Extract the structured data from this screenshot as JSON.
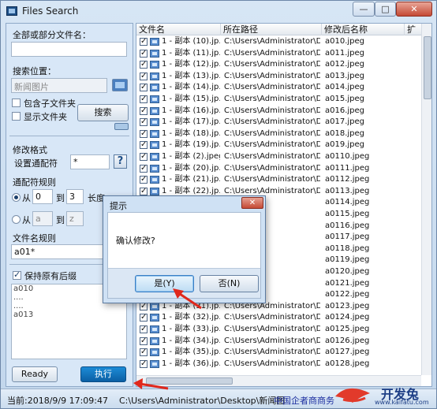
{
  "window": {
    "title": "Files Search",
    "buttons": {
      "minimize": "—",
      "maximize": "□",
      "close": "✕"
    }
  },
  "left": {
    "filename_label": "全部或部分文件名：",
    "filename_value": "",
    "location_label": "搜索位置：",
    "location_value": "新闻图片",
    "include_subfolders": "包含子文件夹",
    "show_folders": "显示文件夹",
    "search_button": "搜索",
    "modify_format_label": "修改格式",
    "wildcard_label": "设置通配符",
    "wildcard_value": "*",
    "help_button": "?",
    "wildcard_rules_label": "通配符规则",
    "from_label": "从",
    "from_value": "0",
    "to_label": "到",
    "to_value": "3",
    "length_label": "长度",
    "from2_label": "从",
    "from2_value": "a",
    "to2_label": "到",
    "to2_value": "z",
    "filename_rule_label": "文件名规则",
    "filename_rule_value": "a01*",
    "keep_ext_label": "保持原有后缀",
    "preview_lines": [
      "a010",
      "....",
      "....",
      "a013"
    ],
    "ready_button": "Ready",
    "execute_button": "执行"
  },
  "list": {
    "columns": [
      "文件名",
      "所在路径",
      "修改后名称",
      "扩"
    ],
    "rows": [
      {
        "name": "1 - 副本 (10).jp...",
        "path": "C:\\Users\\Administrator\\De...",
        "new": "a010.jpeg"
      },
      {
        "name": "1 - 副本 (11).jp...",
        "path": "C:\\Users\\Administrator\\De...",
        "new": "a011.jpeg"
      },
      {
        "name": "1 - 副本 (12).jp...",
        "path": "C:\\Users\\Administrator\\De...",
        "new": "a012.jpeg"
      },
      {
        "name": "1 - 副本 (13).jp...",
        "path": "C:\\Users\\Administrator\\De...",
        "new": "a013.jpeg"
      },
      {
        "name": "1 - 副本 (14).jp...",
        "path": "C:\\Users\\Administrator\\De...",
        "new": "a014.jpeg"
      },
      {
        "name": "1 - 副本 (15).jp...",
        "path": "C:\\Users\\Administrator\\De...",
        "new": "a015.jpeg"
      },
      {
        "name": "1 - 副本 (16).jp...",
        "path": "C:\\Users\\Administrator\\De...",
        "new": "a016.jpeg"
      },
      {
        "name": "1 - 副本 (17).jp...",
        "path": "C:\\Users\\Administrator\\De...",
        "new": "a017.jpeg"
      },
      {
        "name": "1 - 副本 (18).jp...",
        "path": "C:\\Users\\Administrator\\De...",
        "new": "a018.jpeg"
      },
      {
        "name": "1 - 副本 (19).jp...",
        "path": "C:\\Users\\Administrator\\De...",
        "new": "a019.jpeg"
      },
      {
        "name": "1 - 副本 (2).jpeg",
        "path": "C:\\Users\\Administrator\\De...",
        "new": "a0110.jpeg"
      },
      {
        "name": "1 - 副本 (20).jp...",
        "path": "C:\\Users\\Administrator\\De...",
        "new": "a0111.jpeg"
      },
      {
        "name": "1 - 副本 (21).jp...",
        "path": "C:\\Users\\Administrator\\De...",
        "new": "a0112.jpeg"
      },
      {
        "name": "1 - 副本 (22).jp...",
        "path": "C:\\Users\\Administrator\\De...",
        "new": "a0113.jpeg"
      },
      {
        "name": "",
        "path": "",
        "new": "a0114.jpeg"
      },
      {
        "name": "",
        "path": "",
        "new": "a0115.jpeg"
      },
      {
        "name": "",
        "path": "",
        "new": "a0116.jpeg"
      },
      {
        "name": "",
        "path": "",
        "new": "a0117.jpeg"
      },
      {
        "name": "",
        "path": "",
        "new": "a0118.jpeg"
      },
      {
        "name": "",
        "path": "",
        "new": "a0119.jpeg"
      },
      {
        "name": "",
        "path": "",
        "new": "a0120.jpeg"
      },
      {
        "name": "",
        "path": "",
        "new": "a0121.jpeg"
      },
      {
        "name": "",
        "path": "",
        "new": "a0122.jpeg"
      },
      {
        "name": "1 - 副本 (31).jp...",
        "path": "C:\\Users\\Administrator\\De...",
        "new": "a0123.jpeg"
      },
      {
        "name": "1 - 副本 (32).jp...",
        "path": "C:\\Users\\Administrator\\De...",
        "new": "a0124.jpeg"
      },
      {
        "name": "1 - 副本 (33).jp...",
        "path": "C:\\Users\\Administrator\\De...",
        "new": "a0125.jpeg"
      },
      {
        "name": "1 - 副本 (34).jp...",
        "path": "C:\\Users\\Administrator\\De...",
        "new": "a0126.jpeg"
      },
      {
        "name": "1 - 副本 (35).jp...",
        "path": "C:\\Users\\Administrator\\De...",
        "new": "a0127.jpeg"
      },
      {
        "name": "1 - 副本 (36).jp...",
        "path": "C:\\Users\\Administrator\\De...",
        "new": "a0128.jpeg"
      }
    ]
  },
  "status": {
    "time": "当前:2018/9/9 17:09:47",
    "path": "C:\\Users\\Administrator\\Desktop\\新闻图"
  },
  "dialog": {
    "title": "提示",
    "close": "✕",
    "message": "确认修改?",
    "yes_button": "是(Y)",
    "no_button": "否(N)"
  },
  "watermark": {
    "brand": "开发兔",
    "url": "www.kaifatu.com",
    "overlay_text": "中国企者商商务"
  },
  "colors": {
    "accent": "#3b7fc4",
    "arrow": "#e0281c",
    "watermark": "#1e3f86"
  }
}
